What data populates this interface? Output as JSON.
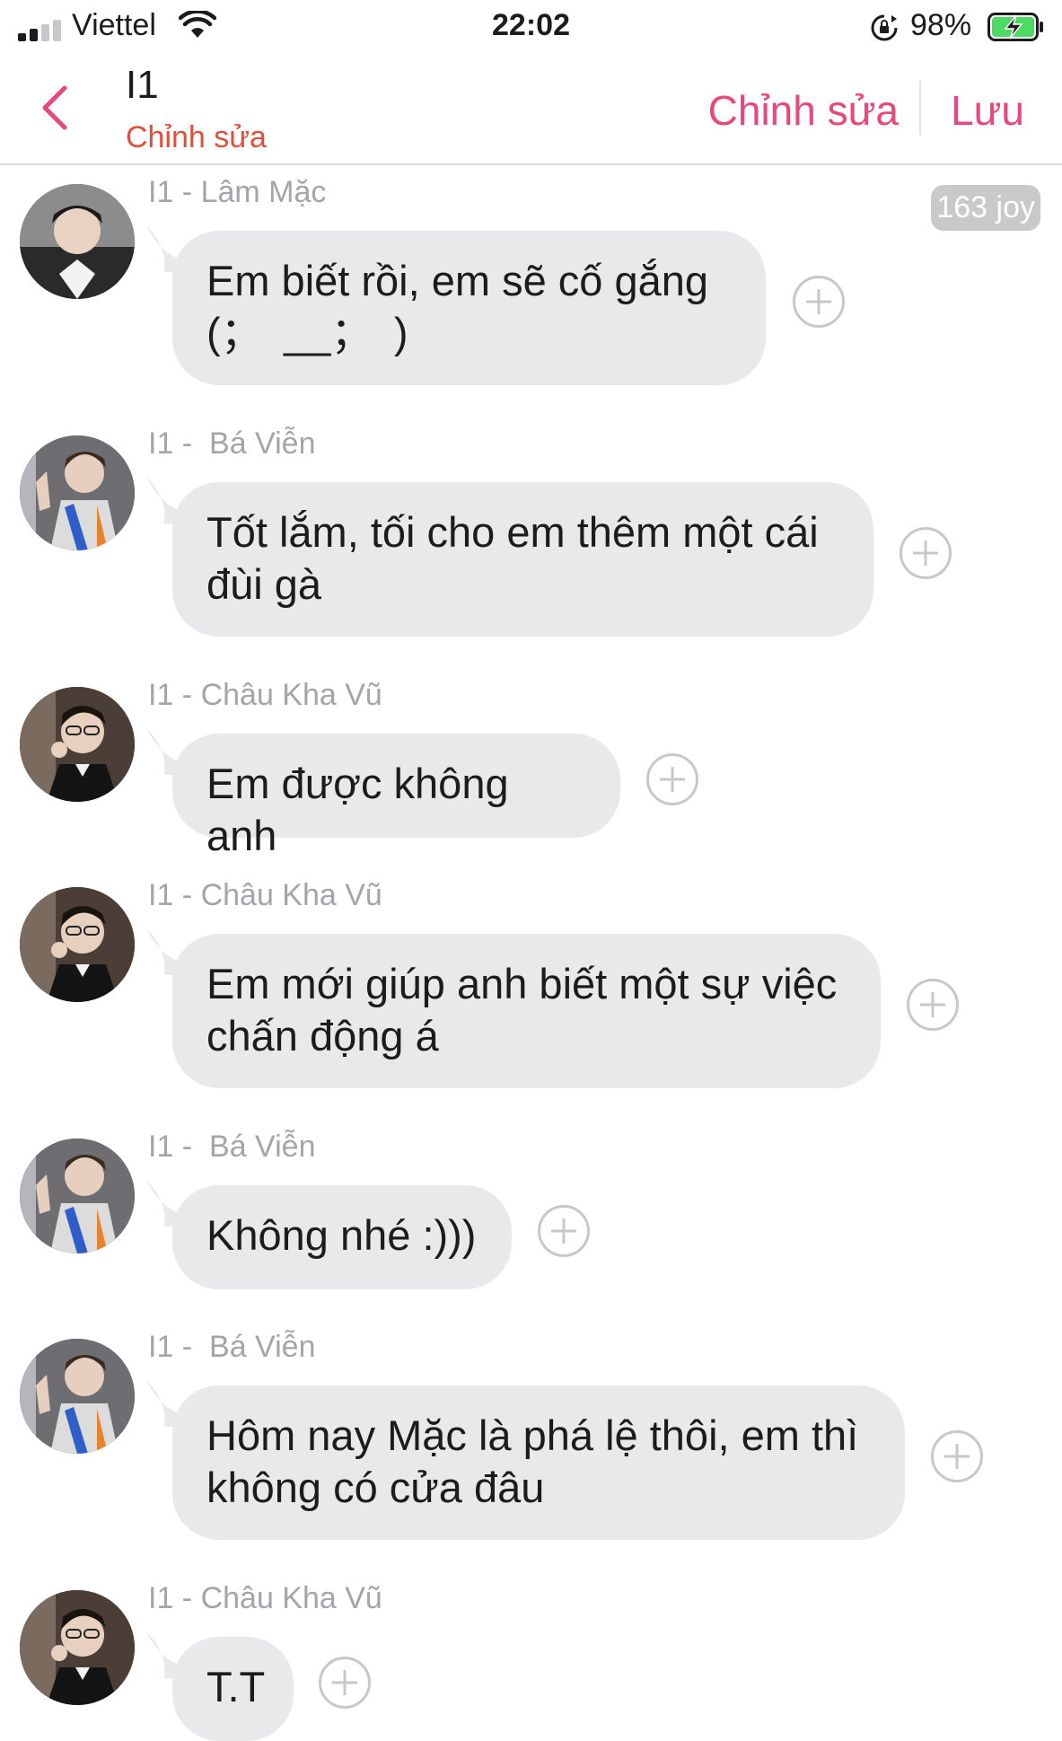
{
  "status_bar": {
    "carrier": "Viettel",
    "time": "22:02",
    "battery_percent": "98%",
    "signal_bars": 2,
    "icons": [
      "signal-icon",
      "wifi-icon",
      "rotation-lock-icon",
      "battery-charging-icon"
    ]
  },
  "header": {
    "title": "I1",
    "subtitle": "Chỉnh sửa",
    "edit_label": "Chỉnh sửa",
    "save_label": "Lưu"
  },
  "joy_badge": "163 joy",
  "colors": {
    "accent": "#e8497c",
    "subtitle": "#e0503a",
    "bubble": "#e9e9ec",
    "sender": "#a4a4aa"
  },
  "messages": [
    {
      "sender": "I1 - Lâm Mặc",
      "text": "Em biết rồi, em sẽ cố gắng\n(；　__；　)",
      "avatar": "avatar-lam-mac"
    },
    {
      "sender": "I1 -  Bá Viễn",
      "text": "Tốt lắm, tối cho em thêm một cái\nđùi gà",
      "avatar": "avatar-ba-vien"
    },
    {
      "sender": "I1 - Châu Kha Vũ",
      "text": "Em được không anh",
      "avatar": "avatar-chau-kha-vu"
    },
    {
      "sender": "I1 - Châu Kha Vũ",
      "text": "Em mới giúp anh biết một sự việc\nchấn động á",
      "avatar": "avatar-chau-kha-vu"
    },
    {
      "sender": "I1 -  Bá Viễn",
      "text": "Không nhé :)))",
      "avatar": "avatar-ba-vien"
    },
    {
      "sender": "I1 -  Bá Viễn",
      "text": "Hôm nay Mặc là phá lệ thôi, em thì\nkhông có cửa đâu",
      "avatar": "avatar-ba-vien"
    },
    {
      "sender": "I1 - Châu Kha Vũ",
      "text": "T.T",
      "avatar": "avatar-chau-kha-vu"
    }
  ]
}
